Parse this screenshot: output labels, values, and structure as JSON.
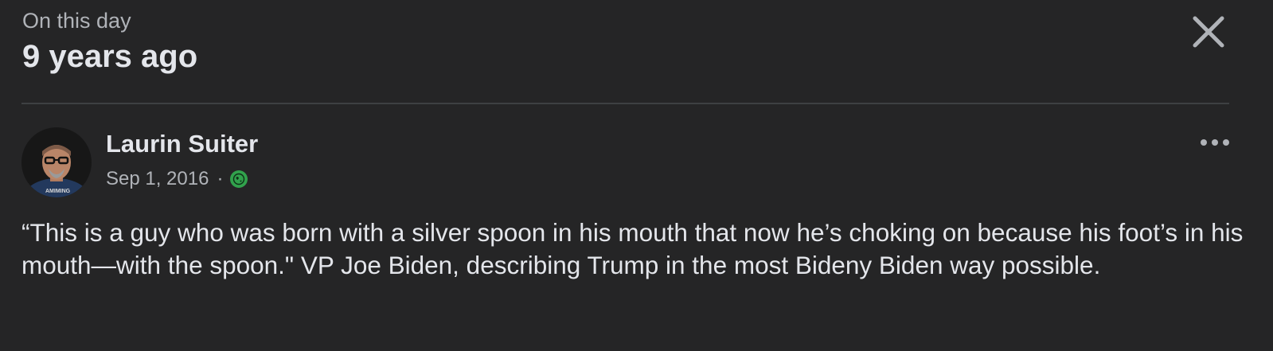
{
  "memory": {
    "subtitle": "On this day",
    "title": "9 years ago",
    "close_icon": "close-x-icon"
  },
  "post": {
    "author": "Laurin Suiter",
    "date": "Sep 1, 2016",
    "separator": "·",
    "audience_icon": "public-globe-icon",
    "more_icon": "more-options-icon",
    "body": "“This is a guy who was born with a silver spoon in his mouth that now he’s choking on because his foot’s in his mouth—with the spoon.\" VP Joe Biden, describing Trump in the most Bideny Biden way possible."
  },
  "colors": {
    "background": "#252526",
    "text_primary": "#e4e6eb",
    "text_secondary": "#b0b3b8",
    "divider": "#3e4042",
    "audience_badge": "#31a24c"
  }
}
